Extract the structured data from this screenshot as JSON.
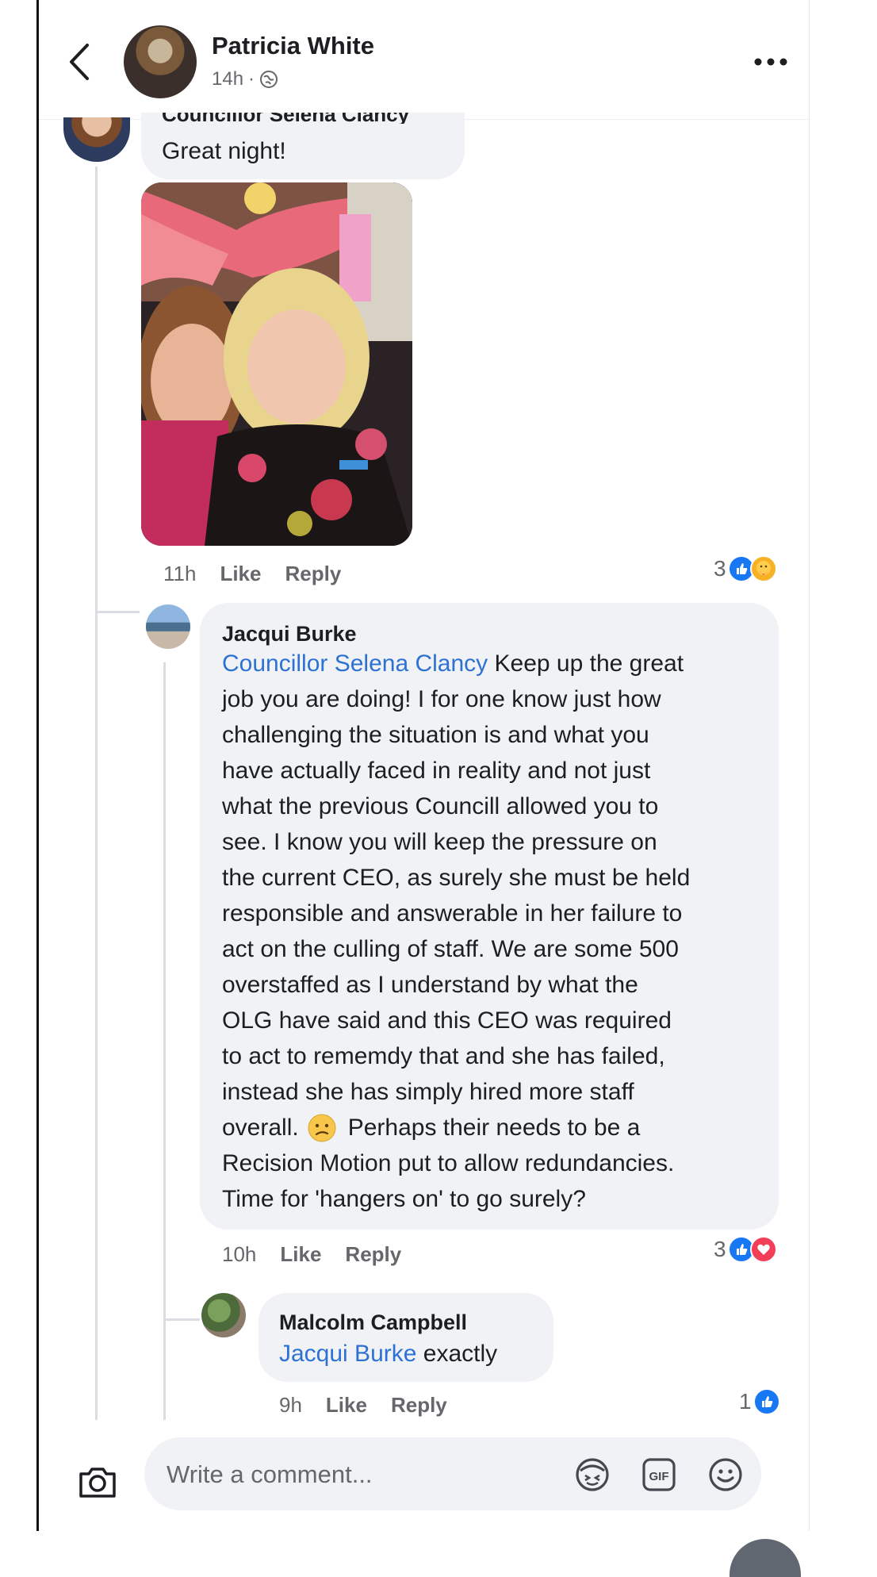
{
  "header": {
    "author": "Patricia White",
    "time": "14h"
  },
  "comment1": {
    "author_cut": "Councillor Selena Clancy",
    "text": "Great night!",
    "time": "11h",
    "like_label": "Like",
    "reply_label": "Reply",
    "reaction_count": "3",
    "reactions": [
      "like-icon",
      "care-icon"
    ]
  },
  "comment2": {
    "author": "Jacqui Burke",
    "mention": "Councillor Selena Clancy",
    "lines": [
      " Keep up the great",
      "job you are doing! I for one know just how",
      "challenging the situation is and what you",
      "have actually faced in reality and not just",
      "what the previous Councill allowed you to",
      "see. I know you will keep the pressure on",
      "the current CEO, as surely she must be held",
      "responsible and answerable in her failure to",
      "act on the culling of staff. We are some 500",
      "overstaffed as I understand by what the",
      "OLG have said and this CEO was  required",
      "to act to rememdy that and she has failed,",
      "instead she has simply hired more staff",
      "overall.",
      "Perhaps their needs to be a",
      "Recision Motion put to allow redundancies.",
      "Time for 'hangers on' to go surely?"
    ],
    "time": "10h",
    "like_label": "Like",
    "reply_label": "Reply",
    "reaction_count": "3",
    "reactions": [
      "like-icon",
      "love-icon"
    ]
  },
  "comment3": {
    "author": "Malcolm Campbell",
    "mention": "Jacqui Burke",
    "text": " exactly",
    "time": "9h",
    "like_label": "Like",
    "reply_label": "Reply",
    "reaction_count": "1",
    "reactions": [
      "like-icon"
    ]
  },
  "composer": {
    "placeholder": "Write a comment..."
  },
  "colors": {
    "accent": "#1877f2",
    "mention": "#2d72d2",
    "bubble": "#f0f2f5",
    "love": "#f33e58"
  }
}
